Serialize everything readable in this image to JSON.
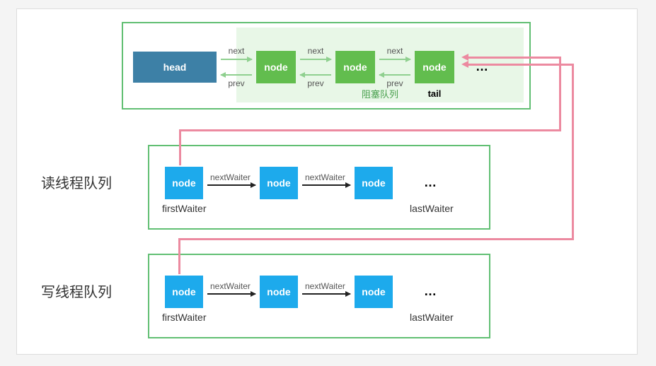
{
  "blocking_queue": {
    "head_label": "head",
    "node_label": "node",
    "tail_label": "tail",
    "next_label": "next",
    "prev_label": "prev",
    "inner_label": "阻塞队列",
    "ellipsis": "…"
  },
  "read_queue": {
    "title": "读线程队列",
    "node_label": "node",
    "first_label": "firstWaiter",
    "last_label": "lastWaiter",
    "nw_label": "nextWaiter",
    "ellipsis": "…"
  },
  "write_queue": {
    "title": "写线程队列",
    "node_label": "node",
    "first_label": "firstWaiter",
    "last_label": "lastWaiter",
    "nw_label": "nextWaiter",
    "ellipsis": "…"
  },
  "colors": {
    "green_border": "#61bf73",
    "green_fill": "#62bd4e",
    "blue_head": "#3d80a6",
    "blue_node": "#1daaec",
    "pink": "#ec8aa0"
  }
}
